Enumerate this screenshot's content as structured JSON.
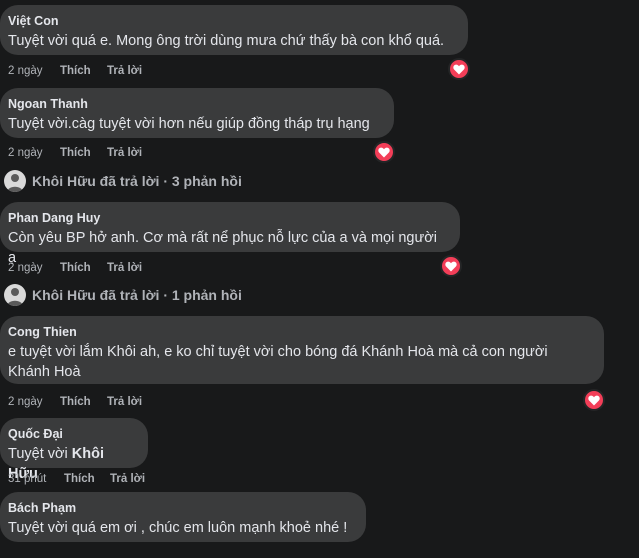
{
  "comments": [
    {
      "author": "Việt Con",
      "text": "Tuyệt vời quá e. Mong ông trời dùng mưa chứ thấy bà con khổ quá.",
      "time": "2 ngày",
      "like": "Thích",
      "reply": "Trả lời"
    },
    {
      "author": "Ngoan Thanh",
      "text": "Tuyệt vời.càg tuyệt vời hơn nếu giúp đồng tháp trụ hạng",
      "time": "2 ngày",
      "like": "Thích",
      "reply": "Trả lời"
    },
    {
      "author": "Phan Dang Huy",
      "text": "Còn yêu BP hở anh. Cơ mà rất nể phục nỗ lực của a và mọi người ạ",
      "time": "2 ngày",
      "like": "Thích",
      "reply": "Trả lời"
    },
    {
      "author": "Cong Thien",
      "text_line1": "e tuyệt vời lắm Khôi ah, e ko chỉ tuyệt vời cho bóng đá Khánh Hoà mà cả con người",
      "text_line2": "Khánh Hoà",
      "time": "2 ngày",
      "like": "Thích",
      "reply": "Trả lời"
    },
    {
      "author": "Quốc Đại",
      "text_prefix": "Tuyệt vời ",
      "mention": "Khôi Hữu",
      "time": "31 phút",
      "like": "Thích",
      "reply": "Trả lời"
    },
    {
      "author": "Bách Phạm",
      "text": "Tuyệt vời quá em ơi , chúc em luôn mạnh khoẻ nhé !"
    }
  ],
  "reply_summaries": [
    {
      "text": "Khôi Hữu đã trả lời · 3 phản hồi"
    },
    {
      "text": "Khôi Hữu đã trả lời · 1 phản hồi"
    }
  ],
  "colors": {
    "background": "#18191a",
    "bubble": "#3a3b3c",
    "heart": "#f33e58",
    "text": "#e4e6eb",
    "meta": "#b0b3b8"
  },
  "icons": {
    "reaction": "heart-icon",
    "avatar": "avatar"
  }
}
